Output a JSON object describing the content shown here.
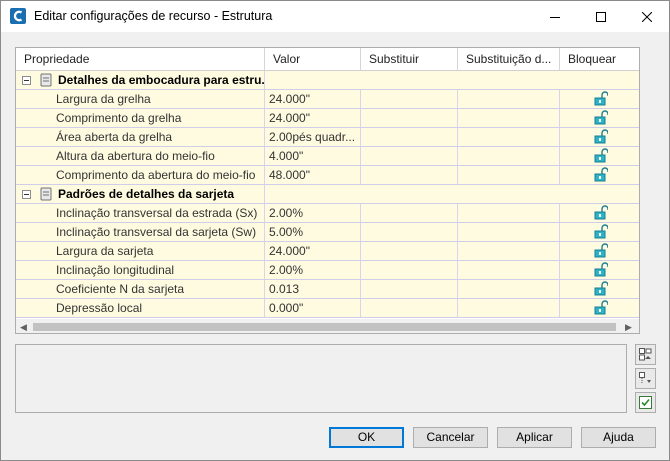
{
  "window": {
    "title": "Editar configurações de recurso - Estrutura",
    "minimize": "minimize",
    "maximize": "maximize",
    "close": "close"
  },
  "grid": {
    "columns": [
      "Propriedade",
      "Valor",
      "Substituir",
      "Substituição d...",
      "Bloquear"
    ],
    "categories": [
      {
        "label": "Detalhes da embocadura para estru...",
        "rows": [
          {
            "prop": "Largura da grelha",
            "value": "24.000\""
          },
          {
            "prop": "Comprimento da grelha",
            "value": "24.000\""
          },
          {
            "prop": "Área aberta da grelha",
            "value": "2.00pés quadr..."
          },
          {
            "prop": "Altura da abertura do meio-fio",
            "value": "4.000\""
          },
          {
            "prop": "Comprimento da abertura do meio-fio",
            "value": "48.000\""
          }
        ]
      },
      {
        "label": "Padrões de detalhes da sarjeta",
        "rows": [
          {
            "prop": "Inclinação transversal da estrada (Sx)",
            "value": "2.00%"
          },
          {
            "prop": "Inclinação transversal da sarjeta (Sw)",
            "value": "5.00%"
          },
          {
            "prop": "Largura da sarjeta",
            "value": "24.000\""
          },
          {
            "prop": "Inclinação longitudinal",
            "value": "2.00%"
          },
          {
            "prop": "Coeficiente N da sarjeta",
            "value": "0.013"
          },
          {
            "prop": "Depressão local",
            "value": "0.000\""
          }
        ]
      }
    ]
  },
  "buttons": {
    "ok": "OK",
    "cancel": "Cancelar",
    "apply": "Aplicar",
    "help": "Ajuda"
  },
  "icons": {
    "app": "civil3d-app-icon",
    "lock": "unlocked-padlock-icon",
    "category": "category-icon"
  },
  "colors": {
    "row_bg": "#fffbe0",
    "accent": "#0078d7",
    "lock": "#1fa3b8"
  }
}
